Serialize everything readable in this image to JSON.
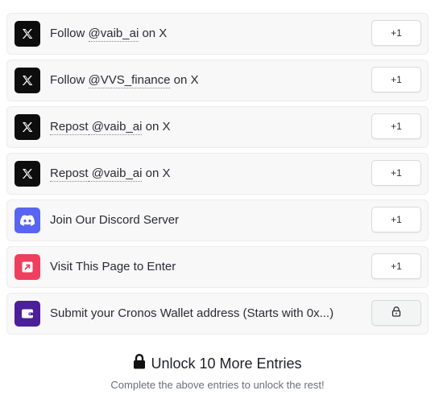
{
  "entries": [
    {
      "label_pre": "Follow ",
      "handle": "@vaib_ai",
      "label_post": " on X",
      "icon": "x-logo-icon",
      "button": "+1"
    },
    {
      "label_pre": "Follow ",
      "handle": "@VVS_finance",
      "label_post": " on X",
      "icon": "x-logo-icon",
      "button": "+1"
    },
    {
      "label_pre": "Repost",
      "handle": " @vaib_ai",
      "label_post": " on X",
      "icon": "x-logo-icon",
      "button": "+1"
    },
    {
      "label_pre": "Repost",
      "handle": " @vaib_ai",
      "label_post": " on X",
      "icon": "x-logo-icon",
      "button": "+1"
    },
    {
      "label": "Join Our Discord Server",
      "icon": "discord-icon",
      "button": "+1"
    },
    {
      "label": "Visit This Page to Enter",
      "icon": "external-link-icon",
      "button": "+1"
    },
    {
      "label": "Submit your Cronos Wallet address (Starts with 0x...)",
      "icon": "wallet-icon",
      "button_icon": "lock-icon"
    }
  ],
  "unlock": {
    "title": "Unlock 10 More Entries",
    "subtitle": "Complete the above entries to unlock the rest!"
  },
  "colors": {
    "x": "#0d0d0d",
    "discord": "#5865f2",
    "visit": "#ef3f5e",
    "wallet": "#4b1f9a"
  }
}
